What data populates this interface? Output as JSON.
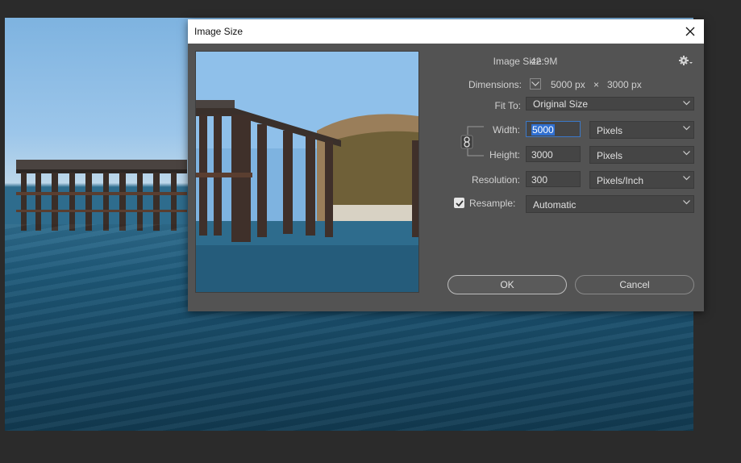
{
  "dialog": {
    "title": "Image Size",
    "image_size_label": "Image Size:",
    "image_size_value": "42.9M",
    "dimensions_label": "Dimensions:",
    "dimensions_width": "5000 px",
    "dimensions_times": "×",
    "dimensions_height": "3000 px",
    "fit_to_label": "Fit To:",
    "fit_to_value": "Original Size",
    "width_label": "Width:",
    "width_value": "5000",
    "width_unit": "Pixels",
    "height_label": "Height:",
    "height_value": "3000",
    "height_unit": "Pixels",
    "resolution_label": "Resolution:",
    "resolution_value": "300",
    "resolution_unit": "Pixels/Inch",
    "resample_label": "Resample:",
    "resample_checked": true,
    "resample_value": "Automatic",
    "ok_label": "OK",
    "cancel_label": "Cancel"
  },
  "icons": {
    "close": "close-icon",
    "settings": "gear-icon",
    "dimensions_toggle": "chevron-down-icon",
    "constrain": "link-icon",
    "dropdown": "chevron-down-icon",
    "check": "check-icon"
  },
  "colors": {
    "dialog_bg": "#535353",
    "titlebar_bg": "#ffffff",
    "focus_border": "#3b78c8",
    "selection": "#2f6fd1"
  }
}
